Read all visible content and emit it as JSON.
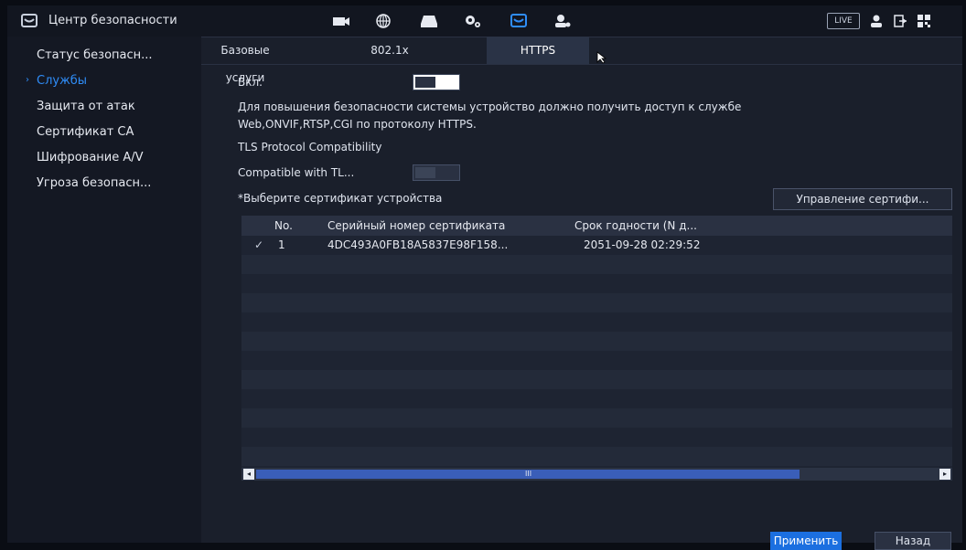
{
  "app": {
    "title": "Центр безопасности"
  },
  "topbar": {
    "live_label": "LIVE"
  },
  "sidebar": {
    "items": [
      {
        "label": "Статус безопасн...",
        "active": false
      },
      {
        "label": "Службы",
        "active": true
      },
      {
        "label": "Защита от атак",
        "active": false
      },
      {
        "label": "Сертификат CA",
        "active": false
      },
      {
        "label": "Шифрование A/V",
        "active": false
      },
      {
        "label": "Угроза безопасн...",
        "active": false
      }
    ],
    "active_arrow": "›"
  },
  "tabs": [
    {
      "label": "Базовые услуги",
      "active": false
    },
    {
      "label": "802.1x",
      "active": false
    },
    {
      "label": "HTTPS",
      "active": true
    }
  ],
  "https": {
    "enable_label": "Вкл.",
    "enable_on": true,
    "description_line1": "Для повышения безопасности системы устройство должно получить доступ к службе",
    "description_line2": "Web,ONVIF,RTSP,CGI по протоколу HTTPS.",
    "tls_heading": "TLS Protocol Compatibility",
    "compat_label": "Compatible with TL...",
    "compat_on": false,
    "select_cert_label": "*Выберите сертификат устройства",
    "manage_cert_button": "Управление сертифи..."
  },
  "table": {
    "columns": [
      "No.",
      "Серийный номер сертификата",
      "Срок годности (N д..."
    ],
    "rows": [
      {
        "check": "✓",
        "no": "1",
        "serial": "4DC493A0FB18A5837E98F158...",
        "expiry": "2051-09-28 02:29:52"
      }
    ],
    "scroll_grip": "III",
    "scroll_left": "◂",
    "scroll_right": "▸"
  },
  "footer": {
    "apply_label": "Применить",
    "back_label": "Назад"
  },
  "colors": {
    "accent": "#2f8df8",
    "apply": "#1b6fe0",
    "bg": "#1a1f2b"
  }
}
